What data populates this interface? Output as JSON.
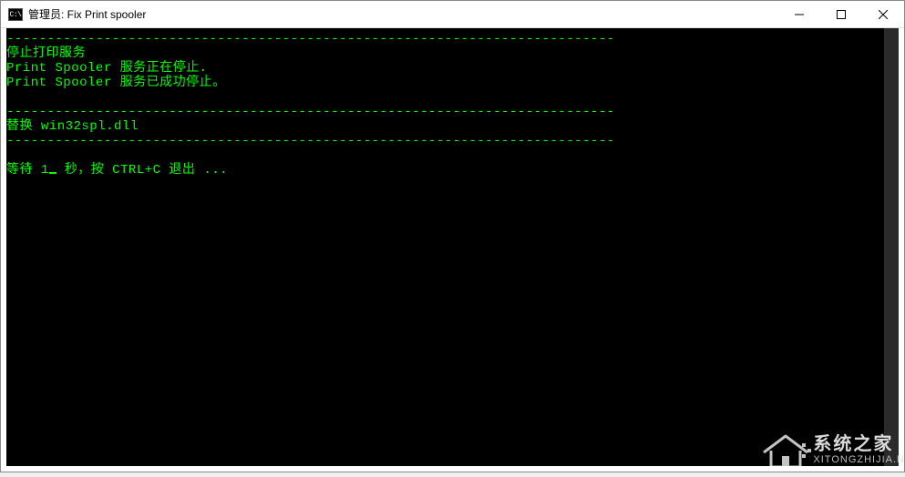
{
  "window": {
    "title": "管理员:  Fix Print spooler",
    "cmd_icon_label": "C:\\"
  },
  "console": {
    "divider": "---------------------------------------------------------------------------",
    "line_stop_service": "停止打印服务",
    "line_stopping": "Print Spooler 服务正在停止.",
    "line_stopped": "Print Spooler 服务已成功停止。",
    "line_replace": "替换 win32spl.dll",
    "wait_prefix": "等待 1",
    "wait_suffix": " 秒，按 CTRL+C 退出 ..."
  },
  "watermark": {
    "main": "系统之家",
    "sub": "XITONGZHIJIA.N"
  }
}
